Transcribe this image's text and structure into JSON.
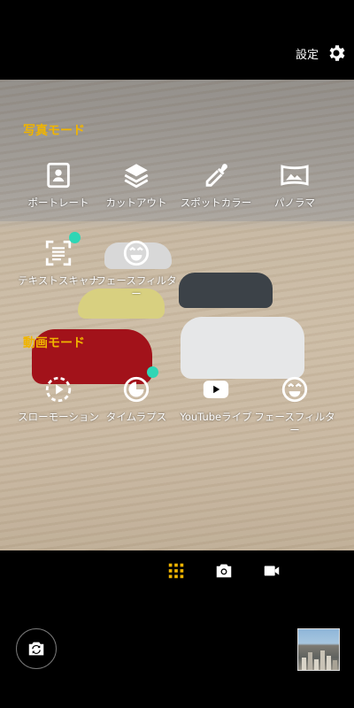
{
  "header": {
    "settings_label": "設定"
  },
  "photo_section": {
    "title": "写真モード",
    "modes": [
      {
        "label": "ポートレート",
        "icon": "portrait-icon",
        "badge": false
      },
      {
        "label": "カットアウト",
        "icon": "cutout-icon",
        "badge": false
      },
      {
        "label": "スポットカラー",
        "icon": "eyedropper-icon",
        "badge": false
      },
      {
        "label": "パノラマ",
        "icon": "panorama-icon",
        "badge": false
      },
      {
        "label": "テキストスキャナ",
        "icon": "text-scanner-icon",
        "badge": true
      },
      {
        "label": "フェースフィルター",
        "icon": "face-filter-icon",
        "badge": false
      }
    ]
  },
  "video_section": {
    "title": "動画モード",
    "modes": [
      {
        "label": "スローモーション",
        "icon": "slow-motion-icon",
        "badge": false
      },
      {
        "label": "タイムラプス",
        "icon": "timelapse-icon",
        "badge": true
      },
      {
        "label": "YouTubeライブ",
        "icon": "youtube-icon",
        "badge": false
      },
      {
        "label": "フェースフィルター",
        "icon": "face-filter-icon",
        "badge": false
      }
    ]
  },
  "bottom": {
    "switches": [
      {
        "name": "mode-grid",
        "icon": "grid-icon",
        "active": true
      },
      {
        "name": "photo",
        "icon": "camera-icon",
        "active": false
      },
      {
        "name": "video",
        "icon": "video-icon",
        "active": false
      }
    ]
  },
  "colors": {
    "accent": "#f0b400",
    "badge": "#2fd6b5",
    "bar_bg": "#000000"
  }
}
